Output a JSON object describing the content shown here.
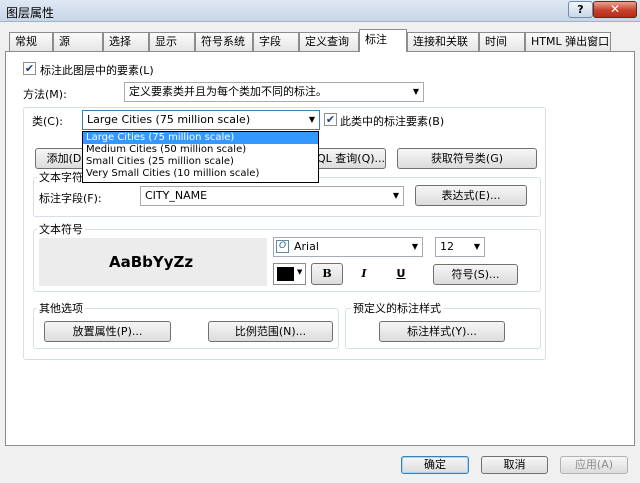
{
  "window": {
    "title": "图层属性",
    "help": "?",
    "close": "✕"
  },
  "tabs": [
    "常规",
    "源",
    "选择",
    "显示",
    "符号系统",
    "字段",
    "定义查询",
    "标注",
    "连接和关联",
    "时间",
    "HTML 弹出窗口"
  ],
  "label_features": {
    "checked": true,
    "label": "标注此图层中的要素(L)"
  },
  "method": {
    "label": "方法(M):",
    "value": "定义要素类并且为每个类加不同的标注。"
  },
  "class": {
    "label": "类(C):",
    "value": "Large Cities (75 million scale)",
    "options": [
      "Large Cities (75 million scale)",
      "Medium Cities (50 million scale)",
      "Small Cities (25 million scale)",
      "Very Small Cities (10 million scale)"
    ],
    "label_features_in_class": {
      "checked": true,
      "label": "此类中的标注要素(B)"
    }
  },
  "buttons": {
    "add": "添加(D",
    "sql": "QL 查询(Q)...",
    "get_symbol_classes": "获取符号类(G)"
  },
  "label_field": {
    "group": "文本字符",
    "label": "标注字段(F):",
    "value": "CITY_NAME",
    "expression": "表达式(E)..."
  },
  "text_symbol": {
    "group": "文本符号",
    "preview": "AaBbYyZz",
    "font": "Arial",
    "size": "12",
    "bold": "B",
    "italic": "I",
    "underline": "U",
    "symbol_button": "符号(S)..."
  },
  "other_options": {
    "group": "其他选项",
    "placement": "放置属性(P)...",
    "scale_range": "比例范围(N)..."
  },
  "predefined": {
    "group": "预定义的标注样式",
    "label_styles": "标注样式(Y)..."
  },
  "footer": {
    "ok": "确定",
    "cancel": "取消",
    "apply": "应用(A)"
  }
}
